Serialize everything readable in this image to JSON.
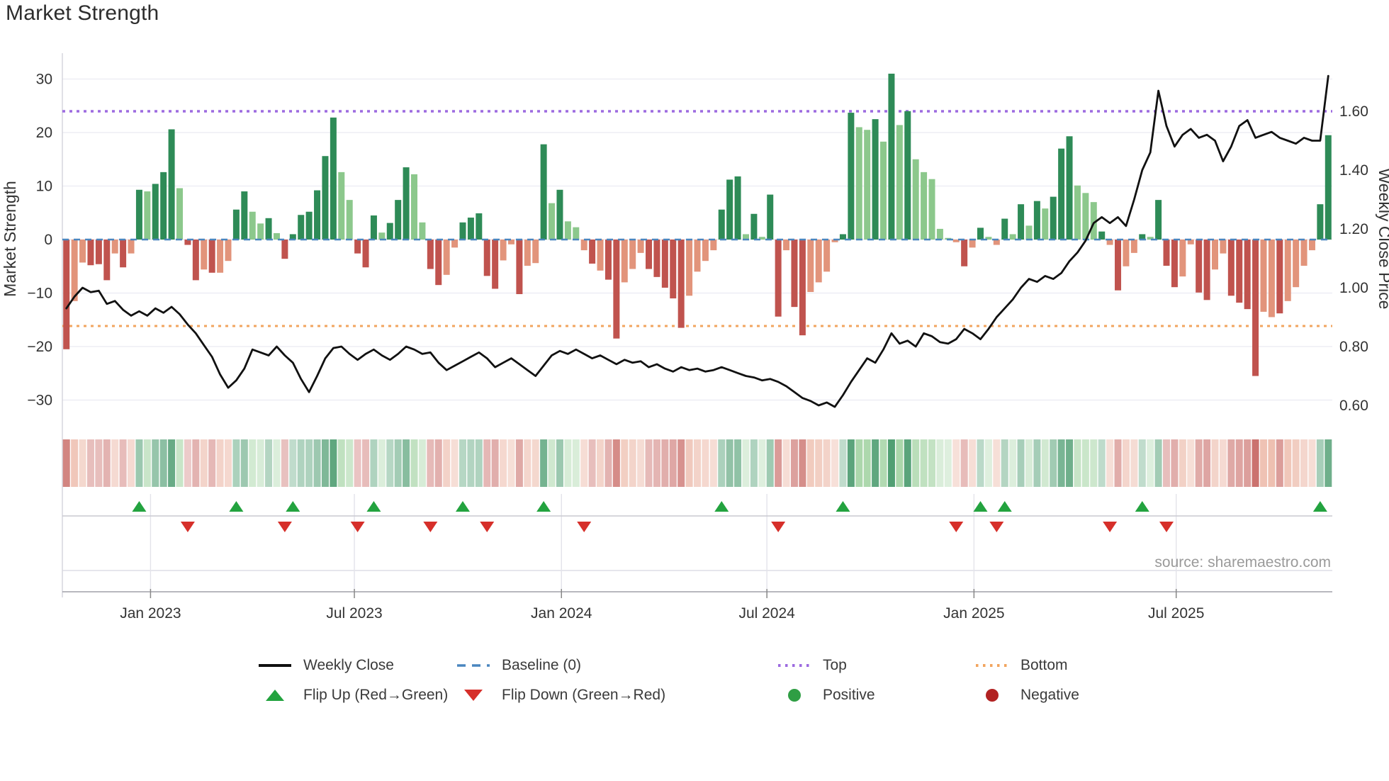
{
  "title": "Market Strength",
  "source_note": "source: sharemaestro.com",
  "axes": {
    "left_title": "Market Strength",
    "right_title": "Weekly Close Price",
    "left_ticks": [
      "30",
      "20",
      "10",
      "0",
      "−10",
      "−20",
      "−30"
    ],
    "left_tick_values": [
      30,
      20,
      10,
      0,
      -10,
      -20,
      -30
    ],
    "right_ticks": [
      "1.60",
      "1.40",
      "1.20",
      "1.00",
      "0.80",
      "0.60"
    ],
    "right_tick_values": [
      1.6,
      1.4,
      1.2,
      1.0,
      0.8,
      0.6
    ],
    "x_ticks": [
      {
        "label": "Jan 2023",
        "week": 10.4
      },
      {
        "label": "Jul 2023",
        "week": 35.6
      },
      {
        "label": "Jan 2024",
        "week": 61.2
      },
      {
        "label": "Jul 2024",
        "week": 86.6
      },
      {
        "label": "Jan 2025",
        "week": 112.2
      },
      {
        "label": "Jul 2025",
        "week": 137.2
      }
    ]
  },
  "chart_data": {
    "type": "combo: weekly strength bars + price line + heatmap strip + flip markers",
    "weeks": 157,
    "ylim_strength": [
      -34.7,
      34.8
    ],
    "ylim_price": [
      0.533,
      1.798
    ],
    "lines": {
      "baseline_value": 0,
      "top_price": 1.6,
      "bottom_price": 0.87
    },
    "strength_values": [
      -20.5,
      -11.5,
      -4.3,
      -4.8,
      -4.6,
      -7.6,
      -2.6,
      -5.2,
      -2.6,
      9.3,
      9.0,
      10.4,
      12.6,
      20.6,
      9.6,
      -1.0,
      -7.6,
      -5.6,
      -6.2,
      -6.2,
      -4.0,
      5.6,
      9.0,
      5.2,
      3.0,
      4.0,
      1.2,
      -3.6,
      1.0,
      4.6,
      5.2,
      9.2,
      15.6,
      22.8,
      12.6,
      7.4,
      -2.6,
      -5.2,
      4.5,
      1.3,
      3.1,
      7.4,
      13.5,
      12.2,
      3.2,
      -5.5,
      -8.5,
      -6.6,
      -1.5,
      3.2,
      4.1,
      4.9,
      -6.8,
      -9.2,
      -3.9,
      -0.9,
      -10.2,
      -4.9,
      -4.4,
      17.8,
      6.8,
      9.3,
      3.4,
      2.3,
      -2.0,
      -4.5,
      -5.8,
      -7.5,
      -18.5,
      -8.0,
      -5.5,
      -2.5,
      -5.5,
      -7.0,
      -9.0,
      -11.0,
      -16.5,
      -10.5,
      -6.0,
      -4.0,
      -2.0,
      5.6,
      11.2,
      11.8,
      1.0,
      4.8,
      0.5,
      8.4,
      -14.4,
      -2.0,
      -12.6,
      -17.9,
      -9.8,
      -8.0,
      -6.0,
      -0.5,
      1.0,
      23.7,
      21.0,
      20.5,
      22.5,
      18.3,
      31.0,
      21.4,
      24.0,
      15.0,
      12.6,
      11.3,
      2.0,
      0.3,
      -0.5,
      -5.0,
      -1.5,
      2.2,
      0.5,
      -1.0,
      3.9,
      1.0,
      6.6,
      2.6,
      7.2,
      5.8,
      8.0,
      17.0,
      19.3,
      10.1,
      8.7,
      7.0,
      1.5,
      -1.0,
      -9.5,
      -5.0,
      -2.5,
      1.0,
      0.5,
      7.4,
      -4.9,
      -8.9,
      -6.9,
      -0.9,
      -9.9,
      -11.3,
      -5.6,
      -2.6,
      -10.5,
      -11.8,
      -13.0,
      -25.5,
      -13.5,
      -14.5,
      -13.8,
      -11.5,
      -8.9,
      -4.9,
      -2.0,
      6.6,
      19.5
    ],
    "strength_shades": [
      "dr",
      "lr",
      "lr",
      "dr",
      "dr",
      "dr",
      "lr",
      "dr",
      "lr",
      "dg",
      "lg",
      "dg",
      "dg",
      "dg",
      "lg",
      "dr",
      "dr",
      "lr",
      "dr",
      "lr",
      "lr",
      "dg",
      "dg",
      "lg",
      "lg",
      "dg",
      "lg",
      "dr",
      "dg",
      "dg",
      "dg",
      "dg",
      "dg",
      "dg",
      "lg",
      "lg",
      "dr",
      "dr",
      "dg",
      "lg",
      "dg",
      "dg",
      "dg",
      "lg",
      "lg",
      "dr",
      "dr",
      "lr",
      "lr",
      "dg",
      "dg",
      "dg",
      "dr",
      "dr",
      "lr",
      "lr",
      "dr",
      "lr",
      "lr",
      "dg",
      "lg",
      "dg",
      "lg",
      "lg",
      "lr",
      "dr",
      "lr",
      "dr",
      "dr",
      "lr",
      "lr",
      "lr",
      "dr",
      "dr",
      "dr",
      "dr",
      "dr",
      "lr",
      "lr",
      "lr",
      "lr",
      "dg",
      "dg",
      "dg",
      "lg",
      "dg",
      "lg",
      "dg",
      "dr",
      "lr",
      "dr",
      "dr",
      "lr",
      "lr",
      "lr",
      "lr",
      "dg",
      "dg",
      "lg",
      "lg",
      "dg",
      "lg",
      "dg",
      "lg",
      "dg",
      "lg",
      "lg",
      "lg",
      "lg",
      "lg",
      "lr",
      "dr",
      "lr",
      "dg",
      "lg",
      "lr",
      "dg",
      "lg",
      "dg",
      "lg",
      "dg",
      "lg",
      "dg",
      "dg",
      "dg",
      "lg",
      "lg",
      "lg",
      "dg",
      "lr",
      "dr",
      "lr",
      "lr",
      "dg",
      "lg",
      "dg",
      "dr",
      "dr",
      "lr",
      "lr",
      "dr",
      "dr",
      "lr",
      "lr",
      "dr",
      "dr",
      "dr",
      "dr",
      "lr",
      "lr",
      "dr",
      "lr",
      "lr",
      "lr",
      "lr",
      "dg",
      "dg"
    ],
    "price": [
      0.93,
      0.97,
      1.0,
      0.985,
      0.99,
      0.945,
      0.955,
      0.925,
      0.905,
      0.92,
      0.905,
      0.93,
      0.915,
      0.935,
      0.91,
      0.875,
      0.845,
      0.805,
      0.765,
      0.705,
      0.66,
      0.685,
      0.725,
      0.79,
      0.78,
      0.77,
      0.8,
      0.77,
      0.745,
      0.69,
      0.645,
      0.7,
      0.76,
      0.795,
      0.8,
      0.775,
      0.755,
      0.775,
      0.79,
      0.77,
      0.755,
      0.775,
      0.8,
      0.79,
      0.775,
      0.78,
      0.745,
      0.72,
      0.735,
      0.75,
      0.765,
      0.78,
      0.76,
      0.73,
      0.745,
      0.76,
      0.74,
      0.72,
      0.7,
      0.735,
      0.77,
      0.785,
      0.775,
      0.79,
      0.775,
      0.76,
      0.77,
      0.755,
      0.74,
      0.755,
      0.745,
      0.75,
      0.73,
      0.74,
      0.725,
      0.715,
      0.73,
      0.72,
      0.725,
      0.715,
      0.72,
      0.73,
      0.72,
      0.71,
      0.7,
      0.695,
      0.685,
      0.69,
      0.68,
      0.665,
      0.645,
      0.625,
      0.615,
      0.6,
      0.61,
      0.595,
      0.635,
      0.68,
      0.72,
      0.76,
      0.745,
      0.79,
      0.845,
      0.81,
      0.82,
      0.8,
      0.845,
      0.835,
      0.815,
      0.81,
      0.825,
      0.86,
      0.845,
      0.825,
      0.86,
      0.9,
      0.93,
      0.96,
      1.0,
      1.03,
      1.02,
      1.04,
      1.03,
      1.05,
      1.09,
      1.12,
      1.16,
      1.22,
      1.24,
      1.22,
      1.24,
      1.21,
      1.3,
      1.4,
      1.46,
      1.67,
      1.55,
      1.48,
      1.52,
      1.54,
      1.51,
      1.52,
      1.5,
      1.43,
      1.48,
      1.55,
      1.57,
      1.51,
      1.52,
      1.53,
      1.51,
      1.5,
      1.49,
      1.51,
      1.5,
      1.5,
      1.72
    ],
    "flip_up_weeks": [
      9,
      21,
      28,
      38,
      49,
      59,
      81,
      96,
      113,
      116,
      133,
      155
    ],
    "flip_down_weeks": [
      15,
      27,
      36,
      45,
      52,
      64,
      88,
      110,
      115,
      129,
      136
    ]
  },
  "legend": {
    "columns": [
      {
        "items": [
          {
            "label": "Weekly Close",
            "swatch": "line-black",
            "name": "legend-weekly-close"
          },
          {
            "label": "Flip Up (Red→Green)",
            "swatch": "tri-up",
            "name": "legend-flip-up"
          }
        ]
      },
      {
        "items": [
          {
            "label": "Baseline (0)",
            "swatch": "dash-blue",
            "name": "legend-baseline"
          },
          {
            "label": "Flip Down (Green→Red)",
            "swatch": "tri-down",
            "name": "legend-flip-down"
          }
        ]
      },
      {
        "items": [
          {
            "label": "Top",
            "swatch": "dot-purple",
            "name": "legend-top"
          },
          {
            "label": "Positive",
            "swatch": "dot-green",
            "name": "legend-positive"
          }
        ]
      },
      {
        "items": [
          {
            "label": "Bottom",
            "swatch": "dot-orange",
            "name": "legend-bottom"
          },
          {
            "label": "Negative",
            "swatch": "dot-darkred",
            "name": "legend-negative"
          }
        ]
      }
    ]
  },
  "colors": {
    "dark_green": "#2e8b57",
    "light_green": "#8cc88c",
    "dark_red": "#c0534e",
    "light_red": "#e2947b",
    "price_line": "#111111",
    "baseline": "#4a86bf",
    "top_line": "#9d6be0",
    "bottom_line": "#f2a55f",
    "flip_up": "#23a33f",
    "flip_down": "#d62f2a",
    "positive_dot": "#2f9e44",
    "negative_dot": "#b22222",
    "grid": "#ebebf2",
    "axis_text": "#333333",
    "muted_text": "#9a9a9a"
  }
}
